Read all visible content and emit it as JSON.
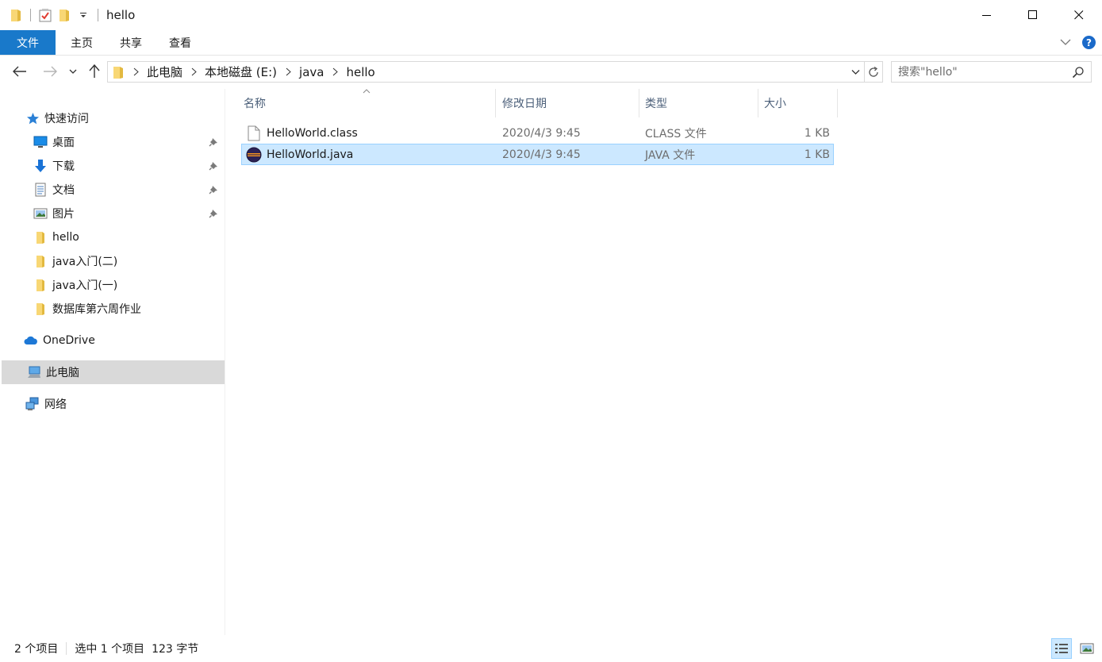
{
  "window": {
    "title": "hello"
  },
  "ribbon": {
    "tabs": [
      {
        "label": "文件"
      },
      {
        "label": "主页"
      },
      {
        "label": "共享"
      },
      {
        "label": "查看"
      }
    ],
    "help": "?"
  },
  "address": {
    "crumbs": [
      "此电脑",
      "本地磁盘 (E:)",
      "java",
      "hello"
    ]
  },
  "search": {
    "placeholder": "搜索\"hello\""
  },
  "sidebar": {
    "items": [
      {
        "label": "快速访问",
        "icon": "star-icon"
      },
      {
        "label": "桌面",
        "icon": "desktop-icon",
        "pinned": true
      },
      {
        "label": "下载",
        "icon": "download-icon",
        "pinned": true
      },
      {
        "label": "文档",
        "icon": "document-icon",
        "pinned": true
      },
      {
        "label": "图片",
        "icon": "picture-icon",
        "pinned": true
      },
      {
        "label": "hello",
        "icon": "folder-icon"
      },
      {
        "label": "java入门(二)",
        "icon": "folder-icon"
      },
      {
        "label": "java入门(一)",
        "icon": "folder-icon"
      },
      {
        "label": "数据库第六周作业",
        "icon": "folder-icon"
      },
      {
        "label": "OneDrive",
        "icon": "cloud-icon"
      },
      {
        "label": "此电脑",
        "icon": "computer-icon",
        "selected": true
      },
      {
        "label": "网络",
        "icon": "network-icon"
      }
    ]
  },
  "filelist": {
    "columns": [
      "名称",
      "修改日期",
      "类型",
      "大小"
    ],
    "sort": "名称",
    "rows": [
      {
        "name": "HelloWorld.class",
        "date": "2020/4/3 9:45",
        "type": "CLASS 文件",
        "size": "1 KB",
        "icon": "blank-file-icon",
        "selected": false
      },
      {
        "name": "HelloWorld.java",
        "date": "2020/4/3 9:45",
        "type": "JAVA 文件",
        "size": "1 KB",
        "icon": "java-file-icon",
        "selected": true
      }
    ]
  },
  "status": {
    "count": "2 个项目",
    "selection": "选中 1 个项目  123 字节"
  },
  "colors": {
    "accent": "#1979ca",
    "selection": "#cce8ff",
    "selection_border": "#99d1ff",
    "folder": "#f8d775"
  }
}
